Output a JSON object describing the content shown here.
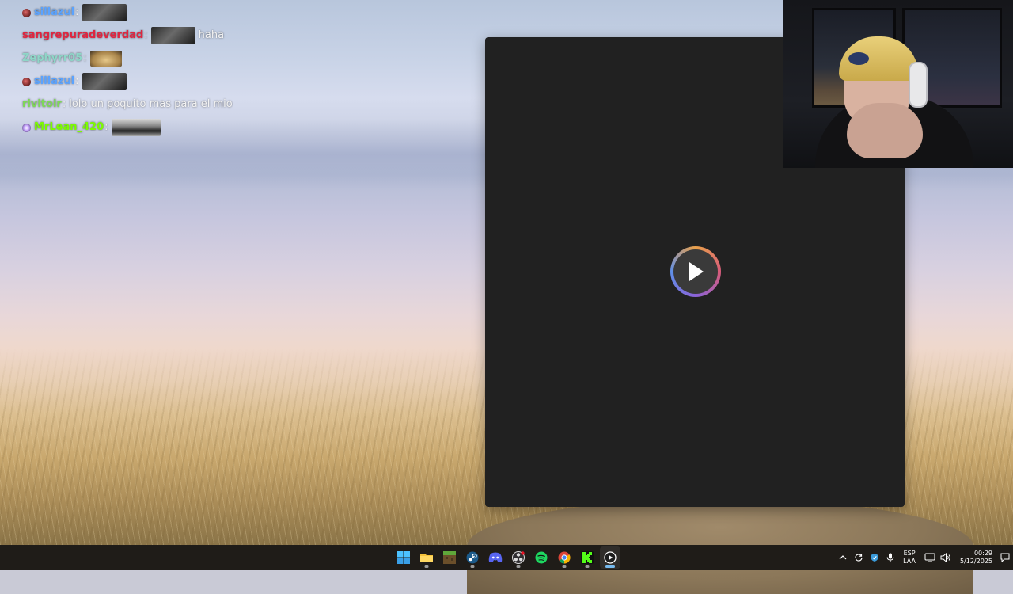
{
  "chat": [
    {
      "user": "sillazul",
      "color": "#5aa3ff",
      "badge": "badge-icon",
      "emote": "emote-dark",
      "message": ""
    },
    {
      "user": "sangrepuradeverdad",
      "color": "#e0253f",
      "badge": "",
      "emote": "emote-dark",
      "message": "haha"
    },
    {
      "user": "Zephyrr05",
      "color": "#8fd6c8",
      "badge": "",
      "emote": "emote-food",
      "message": ""
    },
    {
      "user": "sillazul",
      "color": "#5aa3ff",
      "badge": "badge-icon",
      "emote": "emote-dark",
      "message": ""
    },
    {
      "user": "rivitolr",
      "color": "#7ed957",
      "badge": "",
      "emote": "",
      "message": "lolo un poquito mas para el mio"
    },
    {
      "user": "MrLean_420",
      "color": "#7cfc00",
      "badge": "badge-icon",
      "emote": "emote-car",
      "message": ""
    }
  ],
  "player": {
    "play_icon": "play-icon",
    "background": "#212121"
  },
  "taskbar": {
    "apps": [
      {
        "name": "windows-start",
        "icon": "windows-icon",
        "active": false
      },
      {
        "name": "file-explorer",
        "icon": "folder-icon",
        "active": false
      },
      {
        "name": "minecraft",
        "icon": "minecraft-icon",
        "active": false
      },
      {
        "name": "steam",
        "icon": "steam-icon",
        "active": false
      },
      {
        "name": "discord",
        "icon": "discord-icon",
        "active": false
      },
      {
        "name": "obs",
        "icon": "obs-icon",
        "active": false
      },
      {
        "name": "spotify",
        "icon": "spotify-icon",
        "active": false
      },
      {
        "name": "chrome",
        "icon": "chrome-icon",
        "active": false
      },
      {
        "name": "kick",
        "icon": "kick-icon",
        "active": false
      },
      {
        "name": "media-player",
        "icon": "media-player-icon",
        "active": true
      }
    ],
    "tray": {
      "language_line1": "ESP",
      "language_line2": "LAA",
      "time": "00:29",
      "date": "5/12/2025"
    }
  },
  "colors": {
    "taskbar": "#1f1c18",
    "accent": "#76b9ed"
  }
}
